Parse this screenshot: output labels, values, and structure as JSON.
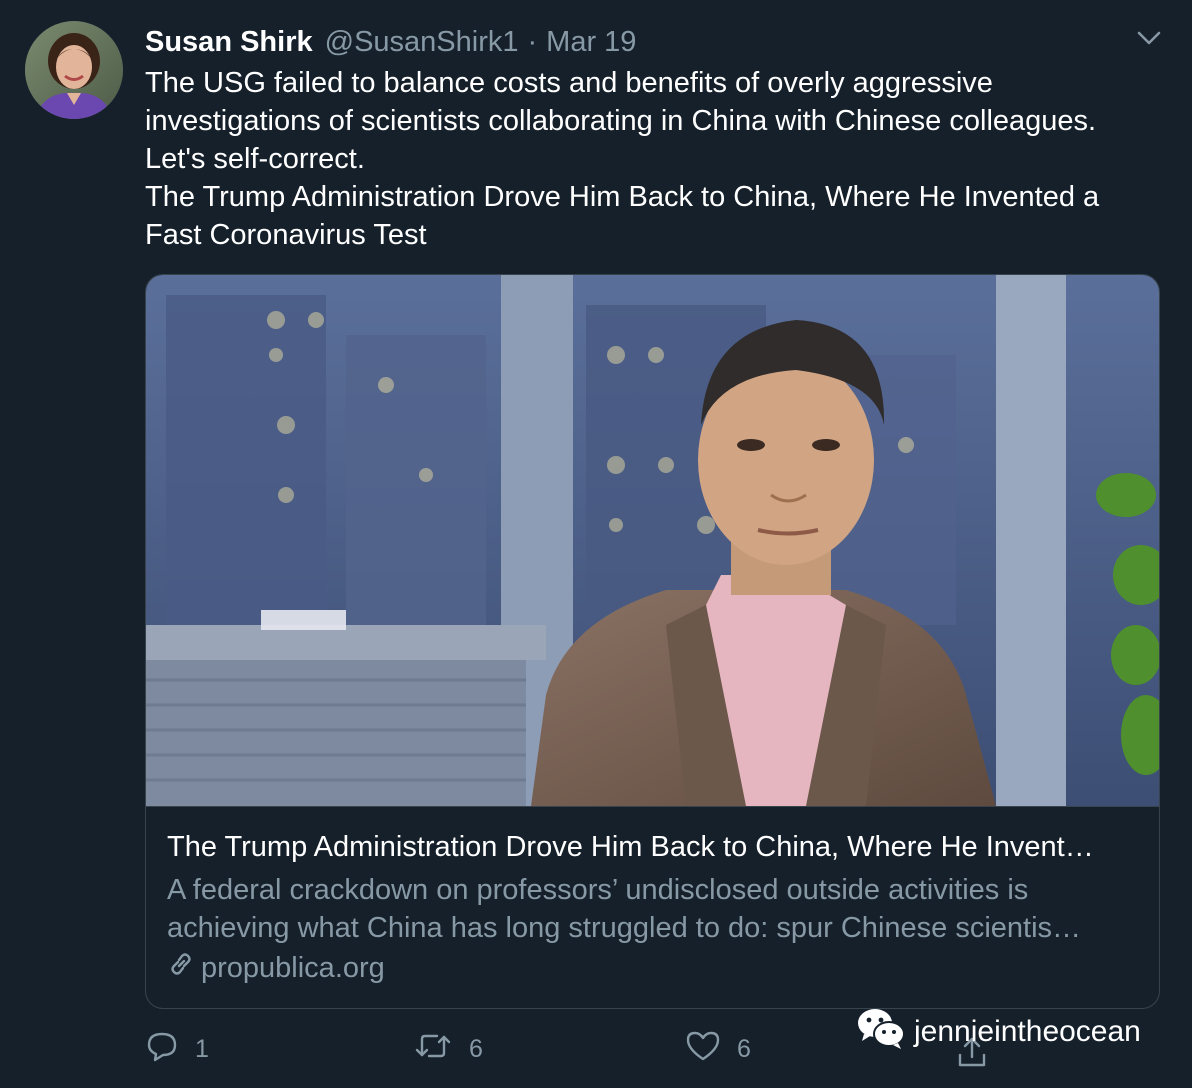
{
  "tweet": {
    "author_name": "Susan Shirk",
    "author_handle": "@SusanShirk1",
    "separator": "·",
    "date": "Mar 19",
    "text_lines": [
      "The USG failed to balance  costs and benefits of overly aggressive",
      "investigations of scientists collaborating in China with Chinese colleagues.",
      "Let's self-correct.",
      "The Trump Administration Drove Him Back to China, Where He Invented a",
      "Fast Coronavirus Test"
    ]
  },
  "card": {
    "title": "The Trump Administration Drove Him Back to China, Where He Invent…",
    "description_lines": [
      "A federal crackdown on professors’ undisclosed outside activities is",
      "achieving what China has long struggled to do: spur Chinese scientis…"
    ],
    "domain": "propublica.org"
  },
  "actions": {
    "reply_count": "1",
    "retweet_count": "6",
    "like_count": "6"
  },
  "watermark": {
    "text": "jennieintheocean"
  },
  "icons": {
    "caret": "chevron-down-icon",
    "link": "link-icon",
    "reply": "reply-icon",
    "retweet": "retweet-icon",
    "like": "heart-icon",
    "share": "share-icon",
    "watermark": "wechat-icon"
  },
  "colors": {
    "background": "#15202b",
    "text_primary": "#ffffff",
    "text_secondary": "#8899a6",
    "border": "#38444d"
  }
}
